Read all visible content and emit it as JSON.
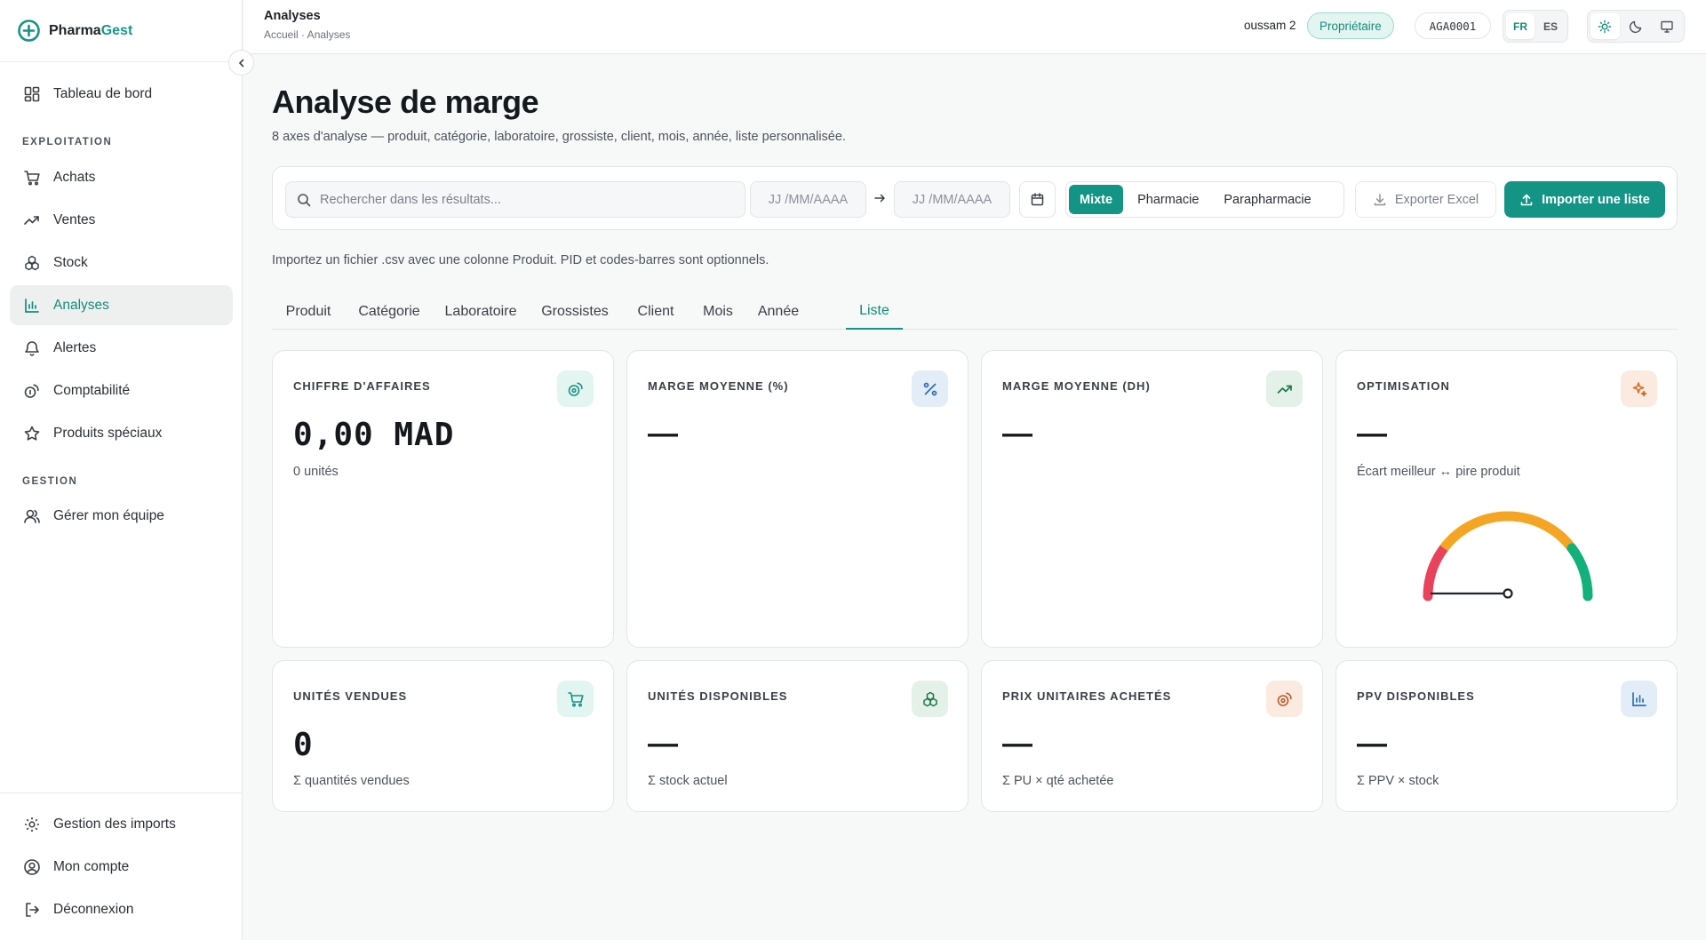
{
  "brand": {
    "name_part1": "Pharma",
    "name_part2": "Gest"
  },
  "sidebar": {
    "top_item": {
      "label": "Tableau de bord",
      "icon": "dashboard-grid-icon"
    },
    "section_exploitation": "EXPLOITATION",
    "exploitation": [
      {
        "label": "Achats",
        "icon": "cart-icon"
      },
      {
        "label": "Ventes",
        "icon": "trend-up-icon"
      },
      {
        "label": "Stock",
        "icon": "boxes-icon"
      },
      {
        "label": "Analyses",
        "icon": "bar-chart-icon",
        "active": true
      },
      {
        "label": "Alertes",
        "icon": "bell-icon"
      },
      {
        "label": "Comptabilité",
        "icon": "coins-icon"
      },
      {
        "label": "Produits spéciaux",
        "icon": "star-icon"
      }
    ],
    "section_gestion": "GESTION",
    "gestion": [
      {
        "label": "Gérer mon équipe",
        "icon": "users-icon"
      }
    ],
    "bottom": [
      {
        "label": "Gestion des imports",
        "icon": "gear-icon"
      },
      {
        "label": "Mon compte",
        "icon": "user-circle-icon"
      },
      {
        "label": "Déconnexion",
        "icon": "logout-icon"
      }
    ]
  },
  "topbar": {
    "title": "Analyses",
    "breadcrumb": "Accueil · Analyses",
    "user": "oussam 2",
    "role": "Propriétaire",
    "code": "AGA0001",
    "languages": [
      "FR",
      "ES"
    ],
    "selected_language": "FR",
    "theme_options": [
      "sun-icon",
      "moon-icon",
      "monitor-icon"
    ],
    "selected_theme": "sun-icon"
  },
  "page": {
    "title": "Analyse de marge",
    "subtitle": "8 axes d'analyse — produit, catégorie, laboratoire, grossiste, client, mois, année, liste personnalisée."
  },
  "toolbar": {
    "search_placeholder": "Rechercher dans les résultats...",
    "date_from_placeholder": "JJ /MM/AAAA",
    "date_to_placeholder": "JJ /MM/AAAA",
    "segments": [
      "Mixte",
      "Pharmacie",
      "Parapharmacie"
    ],
    "selected_segment": "Mixte",
    "export_label": "Exporter Excel",
    "import_label": "Importer une liste"
  },
  "hint": "Importez un fichier .csv avec une colonne Produit. PID et codes-barres sont optionnels.",
  "tabs": [
    "Produit",
    "Catégorie",
    "Laboratoire",
    "Grossistes",
    "Client",
    "Mois",
    "Année",
    "Liste"
  ],
  "selected_tab": "Liste",
  "cards_row1": [
    {
      "label": "CHIFFRE D'AFFAIRES",
      "value": "0,00 MAD",
      "note": "0 unités",
      "icon": "coins-icon",
      "icon_bg": "#e3f5f1",
      "icon_color": "#149484"
    },
    {
      "label": "MARGE MOYENNE (%)",
      "value": "—",
      "note": "",
      "icon": "percent-icon",
      "icon_bg": "#e3edf8",
      "icon_color": "#2f6fb3"
    },
    {
      "label": "MARGE MOYENNE (DH)",
      "value": "—",
      "note": "",
      "icon": "trend-up-icon",
      "icon_bg": "#e3f1e8",
      "icon_color": "#1e7a47"
    },
    {
      "label": "OPTIMISATION",
      "value": "—",
      "note": "Écart meilleur ↔ pire produit",
      "icon": "sparkles-icon",
      "icon_bg": "#fbeadf",
      "icon_color": "#d2691e"
    }
  ],
  "cards_row2": [
    {
      "label": "UNITÉS VENDUES",
      "value": "0",
      "note": "Σ quantités vendues",
      "icon": "cart-icon",
      "icon_bg": "#e3f5f1",
      "icon_color": "#149484"
    },
    {
      "label": "UNITÉS DISPONIBLES",
      "value": "—",
      "note": "Σ stock actuel",
      "icon": "boxes-icon",
      "icon_bg": "#e3f1e8",
      "icon_color": "#1e7a47"
    },
    {
      "label": "PRIX UNITAIRES ACHETÉS",
      "value": "—",
      "note": "Σ PU × qté achetée",
      "icon": "coins-icon",
      "icon_bg": "#fbeadf",
      "icon_color": "#c0592a"
    },
    {
      "label": "PPV DISPONIBLES",
      "value": "—",
      "note": "Σ PPV × stock",
      "icon": "bar-chart-icon",
      "icon_bg": "#e3edf8",
      "icon_color": "#2f6fb3"
    }
  ],
  "colors": {
    "accent": "#149484",
    "gauge_red": "#e8435a",
    "gauge_orange": "#f5a524",
    "gauge_green": "#12b07a"
  }
}
